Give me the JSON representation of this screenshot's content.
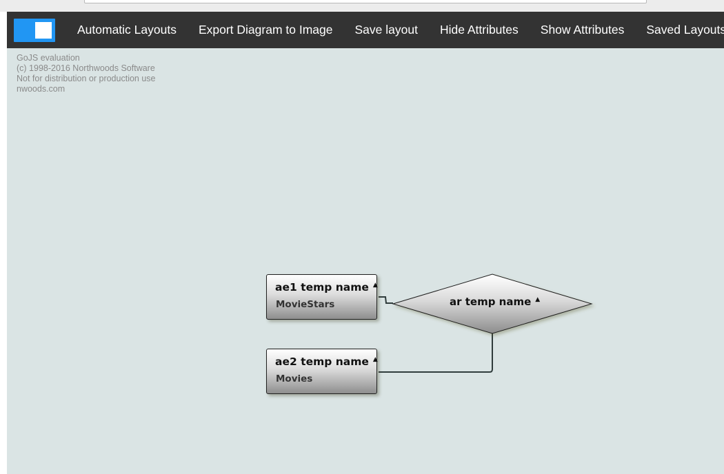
{
  "menu": {
    "toggle_state": "on",
    "items": [
      "Automatic Layouts",
      "Export Diagram to Image",
      "Save layout",
      "Hide Attributes",
      "Show Attributes",
      "Saved Layouts"
    ]
  },
  "watermark": [
    "GoJS evaluation",
    "(c) 1998-2016 Northwoods Software",
    "Not for distribution or production use",
    "nwoods.com"
  ],
  "diagram": {
    "entities": [
      {
        "name": "ae1 temp name",
        "table": "MovieStars"
      },
      {
        "name": "ae2 temp name",
        "table": "Movies"
      }
    ],
    "relationship": {
      "name": "ar temp name"
    },
    "expand_glyph": "▲"
  },
  "colors": {
    "menubar": "#333333",
    "toggle": "#2196f3",
    "canvas": "#dae4e4",
    "link": "#2f3b3b"
  }
}
